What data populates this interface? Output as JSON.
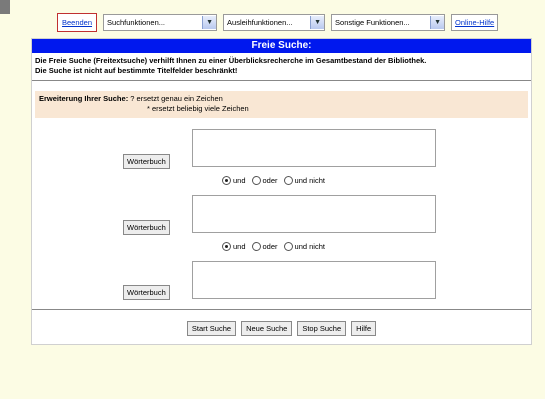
{
  "toolbar": {
    "beenden": "Beenden",
    "suchfunktionen": "Suchfunktionen...",
    "ausleihfunktionen": "Ausleihfunktionen...",
    "sonstige": "Sonstige Funktionen...",
    "hilfe": "Online-Hilfe"
  },
  "panel": {
    "title": "Freie Suche:",
    "intro_line1": "Die Freie Suche (Freitextsuche) verhilft Ihnen zu einer Überblicksrecherche im Gesamtbestand der Bibliothek.",
    "intro_line2": "Die Suche ist nicht auf bestimmte Titelfelder beschränkt!",
    "ext_label": "Erweiterung Ihrer Suche:",
    "ext_line1": " ? ersetzt genau ein Zeichen",
    "ext_line2": "* ersetzt beliebig viele Zeichen",
    "woerterbuch": "Wörterbuch",
    "radio_und": "und",
    "radio_oder": "oder",
    "radio_undnicht": "und nicht",
    "start": "Start Suche",
    "neue": "Neue Suche",
    "stop": "Stop Suche",
    "hilfe": "Hilfe"
  },
  "colors": {
    "titlebar": "#0018ee",
    "background": "#fcfce4",
    "extension_bg": "#f9e7d4"
  },
  "selected_operator": [
    "und",
    "und"
  ]
}
